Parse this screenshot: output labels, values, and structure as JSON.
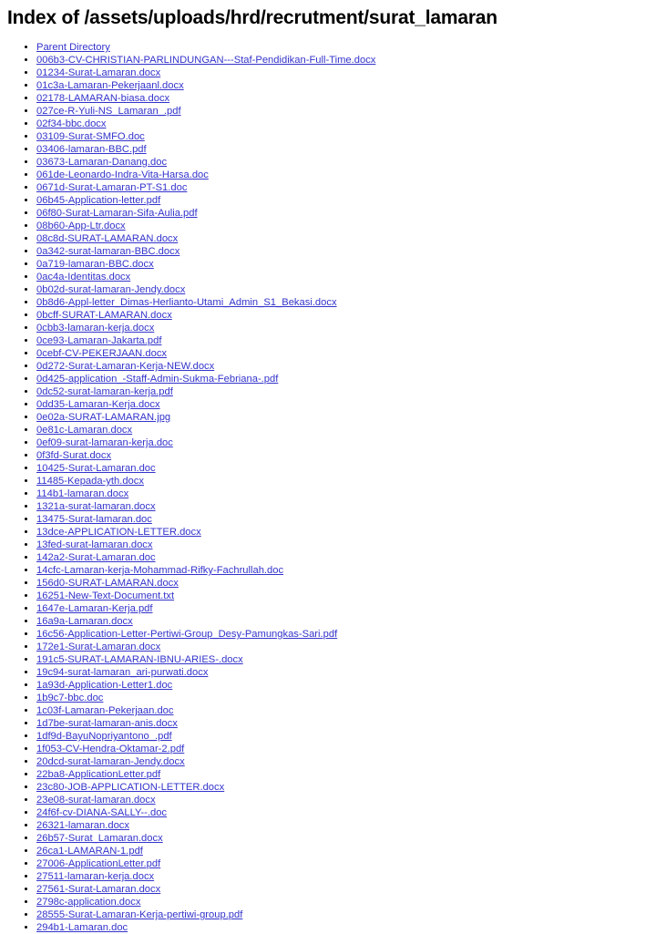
{
  "page": {
    "title": "Index of /assets/uploads/hrd/recrutment/surat_lamaran",
    "path": "/assets/uploads/hrd/recrutment/surat_lamaran",
    "background_color": "#ffffff",
    "text_color": "#000000",
    "link_color": "#3333cc",
    "list_marker": "disc"
  },
  "listing": {
    "items": [
      {
        "label": "Parent Directory"
      },
      {
        "label": "006b3-CV-CHRISTIAN-PARLINDUNGAN---Staf-Pendidikan-Full-Time.docx"
      },
      {
        "label": "01234-Surat-Lamaran.docx"
      },
      {
        "label": "01c3a-Lamaran-Pekerjaanl.docx"
      },
      {
        "label": "02178-LAMARAN-biasa.docx"
      },
      {
        "label": "027ce-R-Yuli-NS_Lamaran_.pdf"
      },
      {
        "label": "02f34-bbc.docx"
      },
      {
        "label": "03109-Surat-SMFO.doc"
      },
      {
        "label": "03406-lamaran-BBC.pdf"
      },
      {
        "label": "03673-Lamaran-Danang.doc"
      },
      {
        "label": "061de-Leonardo-Indra-Vita-Harsa.doc"
      },
      {
        "label": "0671d-Surat-Lamaran-PT-S1.doc"
      },
      {
        "label": "06b45-Application-letter.pdf"
      },
      {
        "label": "06f80-Surat-Lamaran-Sifa-Aulia.pdf"
      },
      {
        "label": "08b60-App-Ltr.docx"
      },
      {
        "label": "08c8d-SURAT-LAMARAN.docx"
      },
      {
        "label": "0a342-surat-lamaran-BBC.docx"
      },
      {
        "label": "0a719-lamaran-BBC.docx"
      },
      {
        "label": "0ac4a-Identitas.docx"
      },
      {
        "label": "0b02d-surat-lamaran-Jendy.docx"
      },
      {
        "label": "0b8d6-Appl-letter_Dimas-Herlianto-Utami_Admin_S1_Bekasi.docx"
      },
      {
        "label": "0bcff-SURAT-LAMARAN.docx"
      },
      {
        "label": "0cbb3-lamaran-kerja.docx"
      },
      {
        "label": "0ce93-Lamaran-Jakarta.pdf"
      },
      {
        "label": "0cebf-CV-PEKERJAAN.docx"
      },
      {
        "label": "0d272-Surat-Lamaran-Kerja-NEW.docx"
      },
      {
        "label": "0d425-application_-Staff-Admin-Sukma-Febriana-.pdf"
      },
      {
        "label": "0dc52-surat-lamaran-kerja.pdf"
      },
      {
        "label": "0dd35-Lamaran-Kerja.docx"
      },
      {
        "label": "0e02a-SURAT-LAMARAN.jpg"
      },
      {
        "label": "0e81c-Lamaran.docx"
      },
      {
        "label": "0ef09-surat-lamaran-kerja.doc"
      },
      {
        "label": "0f3fd-Surat.docx"
      },
      {
        "label": "10425-Surat-Lamaran.doc"
      },
      {
        "label": "11485-Kepada-yth.docx"
      },
      {
        "label": "114b1-lamaran.docx"
      },
      {
        "label": "1321a-surat-lamaran.docx"
      },
      {
        "label": "13475-Surat-lamaran.doc"
      },
      {
        "label": "13dce-APPLICATION-LETTER.docx"
      },
      {
        "label": "13fed-surat-lamaran.docx"
      },
      {
        "label": "142a2-Surat-Lamaran.doc"
      },
      {
        "label": "14cfc-Lamaran-kerja-Mohammad-Rifky-Fachrullah.doc"
      },
      {
        "label": "156d0-SURAT-LAMARAN.docx"
      },
      {
        "label": "16251-New-Text-Document.txt"
      },
      {
        "label": "1647e-Lamaran-Kerja.pdf"
      },
      {
        "label": "16a9a-Lamaran.docx"
      },
      {
        "label": "16c56-Application-Letter-Pertiwi-Group_Desy-Pamungkas-Sari.pdf"
      },
      {
        "label": "172e1-Surat-Lamaran.docx"
      },
      {
        "label": "191c5-SURAT-LAMARAN-IBNU-ARIES-.docx"
      },
      {
        "label": "19c94-surat-lamaran_ari-purwati.docx"
      },
      {
        "label": "1a93d-Application-Letter1.doc"
      },
      {
        "label": "1b9c7-bbc.doc"
      },
      {
        "label": "1c03f-Lamaran-Pekerjaan.doc"
      },
      {
        "label": "1d7be-surat-lamaran-anis.docx"
      },
      {
        "label": "1df9d-BayuNopriyantono_.pdf"
      },
      {
        "label": "1f053-CV-Hendra-Oktamar-2.pdf"
      },
      {
        "label": "20dcd-surat-lamaran-Jendy.docx"
      },
      {
        "label": "22ba8-ApplicationLetter.pdf"
      },
      {
        "label": "23c80-JOB-APPLICATION-LETTER.docx"
      },
      {
        "label": "23e08-surat-lamaran.docx"
      },
      {
        "label": "24f6f-cv-DIANA-SALLY--.doc"
      },
      {
        "label": "26321-lamaran.docx"
      },
      {
        "label": "26b57-Surat_Lamaran.docx"
      },
      {
        "label": "26ca1-LAMARAN-1.pdf"
      },
      {
        "label": "27006-ApplicationLetter.pdf"
      },
      {
        "label": "27511-lamaran-kerja.docx"
      },
      {
        "label": "27561-Surat-Lamaran.docx"
      },
      {
        "label": "2798c-application.docx"
      },
      {
        "label": "28555-Surat-Lamaran-Kerja-pertiwi-group.pdf"
      },
      {
        "label": "294b1-Lamaran.doc"
      }
    ]
  }
}
